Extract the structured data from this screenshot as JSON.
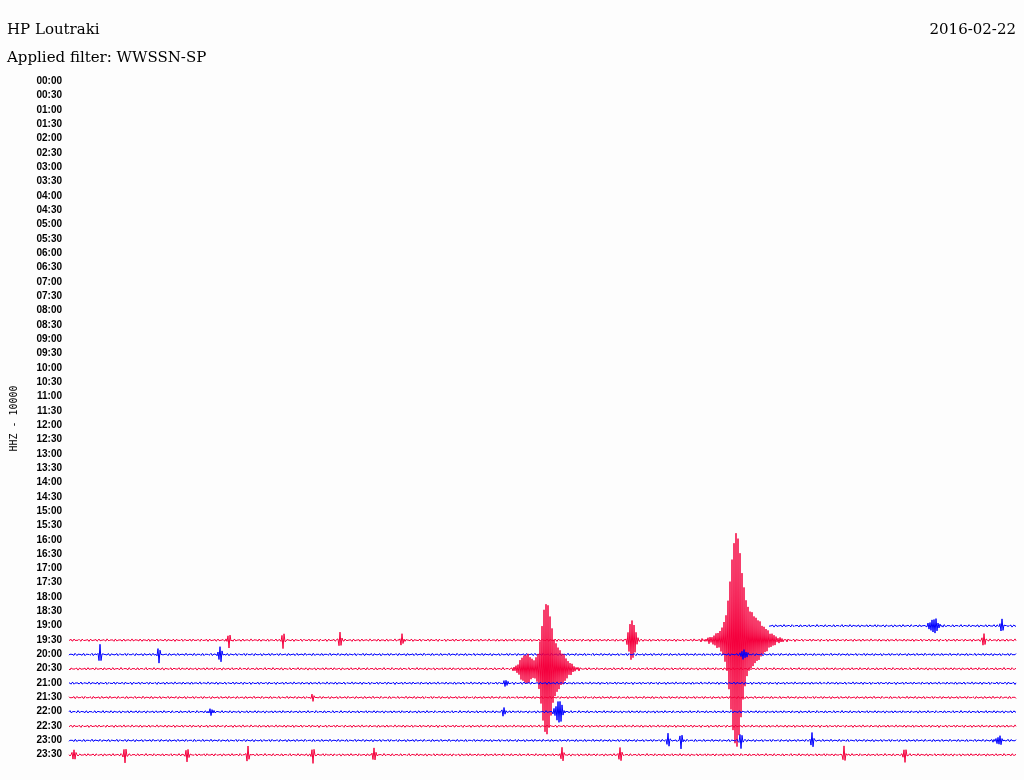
{
  "header": {
    "station": "HP Loutraki",
    "date": "2016-02-22",
    "filter": "Applied filter: WWSSN-SP"
  },
  "channel": "HHZ - 10000",
  "rows": [
    {
      "time": "00:00"
    },
    {
      "time": "00:30"
    },
    {
      "time": "01:00"
    },
    {
      "time": "01:30"
    },
    {
      "time": "02:00"
    },
    {
      "time": "02:30"
    },
    {
      "time": "03:00"
    },
    {
      "time": "03:30"
    },
    {
      "time": "04:00"
    },
    {
      "time": "04:30"
    },
    {
      "time": "05:00"
    },
    {
      "time": "05:30"
    },
    {
      "time": "06:00"
    },
    {
      "time": "06:30"
    },
    {
      "time": "07:00"
    },
    {
      "time": "07:30"
    },
    {
      "time": "08:00"
    },
    {
      "time": "08:30"
    },
    {
      "time": "09:00"
    },
    {
      "time": "09:30"
    },
    {
      "time": "10:00"
    },
    {
      "time": "10:30"
    },
    {
      "time": "11:00"
    },
    {
      "time": "11:30"
    },
    {
      "time": "12:00"
    },
    {
      "time": "12:30"
    },
    {
      "time": "13:00"
    },
    {
      "time": "13:30"
    },
    {
      "time": "14:00"
    },
    {
      "time": "14:30"
    },
    {
      "time": "15:00"
    },
    {
      "time": "15:30"
    },
    {
      "time": "16:00"
    },
    {
      "time": "16:30"
    },
    {
      "time": "17:00"
    },
    {
      "time": "17:30"
    },
    {
      "time": "18:00"
    },
    {
      "time": "18:30"
    },
    {
      "time": "19:00",
      "trace": {
        "kind": "partial",
        "color": "#0000ff"
      }
    },
    {
      "time": "19:30",
      "trace": {
        "kind": "full",
        "color": "#f5003d"
      }
    },
    {
      "time": "20:00",
      "trace": {
        "kind": "full",
        "color": "#0000ff"
      }
    },
    {
      "time": "20:30",
      "trace": {
        "kind": "full",
        "color": "#f5003d"
      }
    },
    {
      "time": "21:00",
      "trace": {
        "kind": "full",
        "color": "#0000ff"
      }
    },
    {
      "time": "21:30",
      "trace": {
        "kind": "full",
        "color": "#f5003d"
      }
    },
    {
      "time": "22:00",
      "trace": {
        "kind": "full",
        "color": "#0000ff"
      }
    },
    {
      "time": "22:30",
      "trace": {
        "kind": "full",
        "color": "#f5003d"
      }
    },
    {
      "time": "23:00",
      "trace": {
        "kind": "full",
        "color": "#0000ff"
      }
    },
    {
      "time": "23:30",
      "trace": {
        "kind": "full",
        "color": "#f5003d"
      }
    }
  ]
}
